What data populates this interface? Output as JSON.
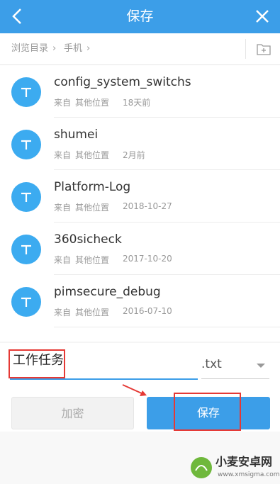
{
  "header": {
    "title": "保存"
  },
  "breadcrumb": {
    "items": [
      "浏览目录",
      "手机"
    ],
    "sep": "›"
  },
  "files": [
    {
      "name": "config_system_switchs",
      "source_label": "来自",
      "source": "其他位置",
      "date": "18天前"
    },
    {
      "name": "shumei",
      "source_label": "来自",
      "source": "其他位置",
      "date": "2月前"
    },
    {
      "name": "Platform-Log",
      "source_label": "来自",
      "source": "其他位置",
      "date": "2018-10-27"
    },
    {
      "name": "360sicheck",
      "source_label": "来自",
      "source": "其他位置",
      "date": "2017-10-20"
    },
    {
      "name": "pimsecure_debug",
      "source_label": "来自",
      "source": "其他位置",
      "date": "2016-07-10"
    }
  ],
  "form": {
    "filename": "工作任务",
    "extension": ".txt",
    "encrypt_label": "加密",
    "save_label": "保存"
  },
  "watermark": {
    "title": "小麦安卓网",
    "url": "www.xmsigma.com"
  },
  "colors": {
    "accent": "#3c9ee8",
    "avatar": "#3cabf0",
    "highlight": "#e53935"
  }
}
